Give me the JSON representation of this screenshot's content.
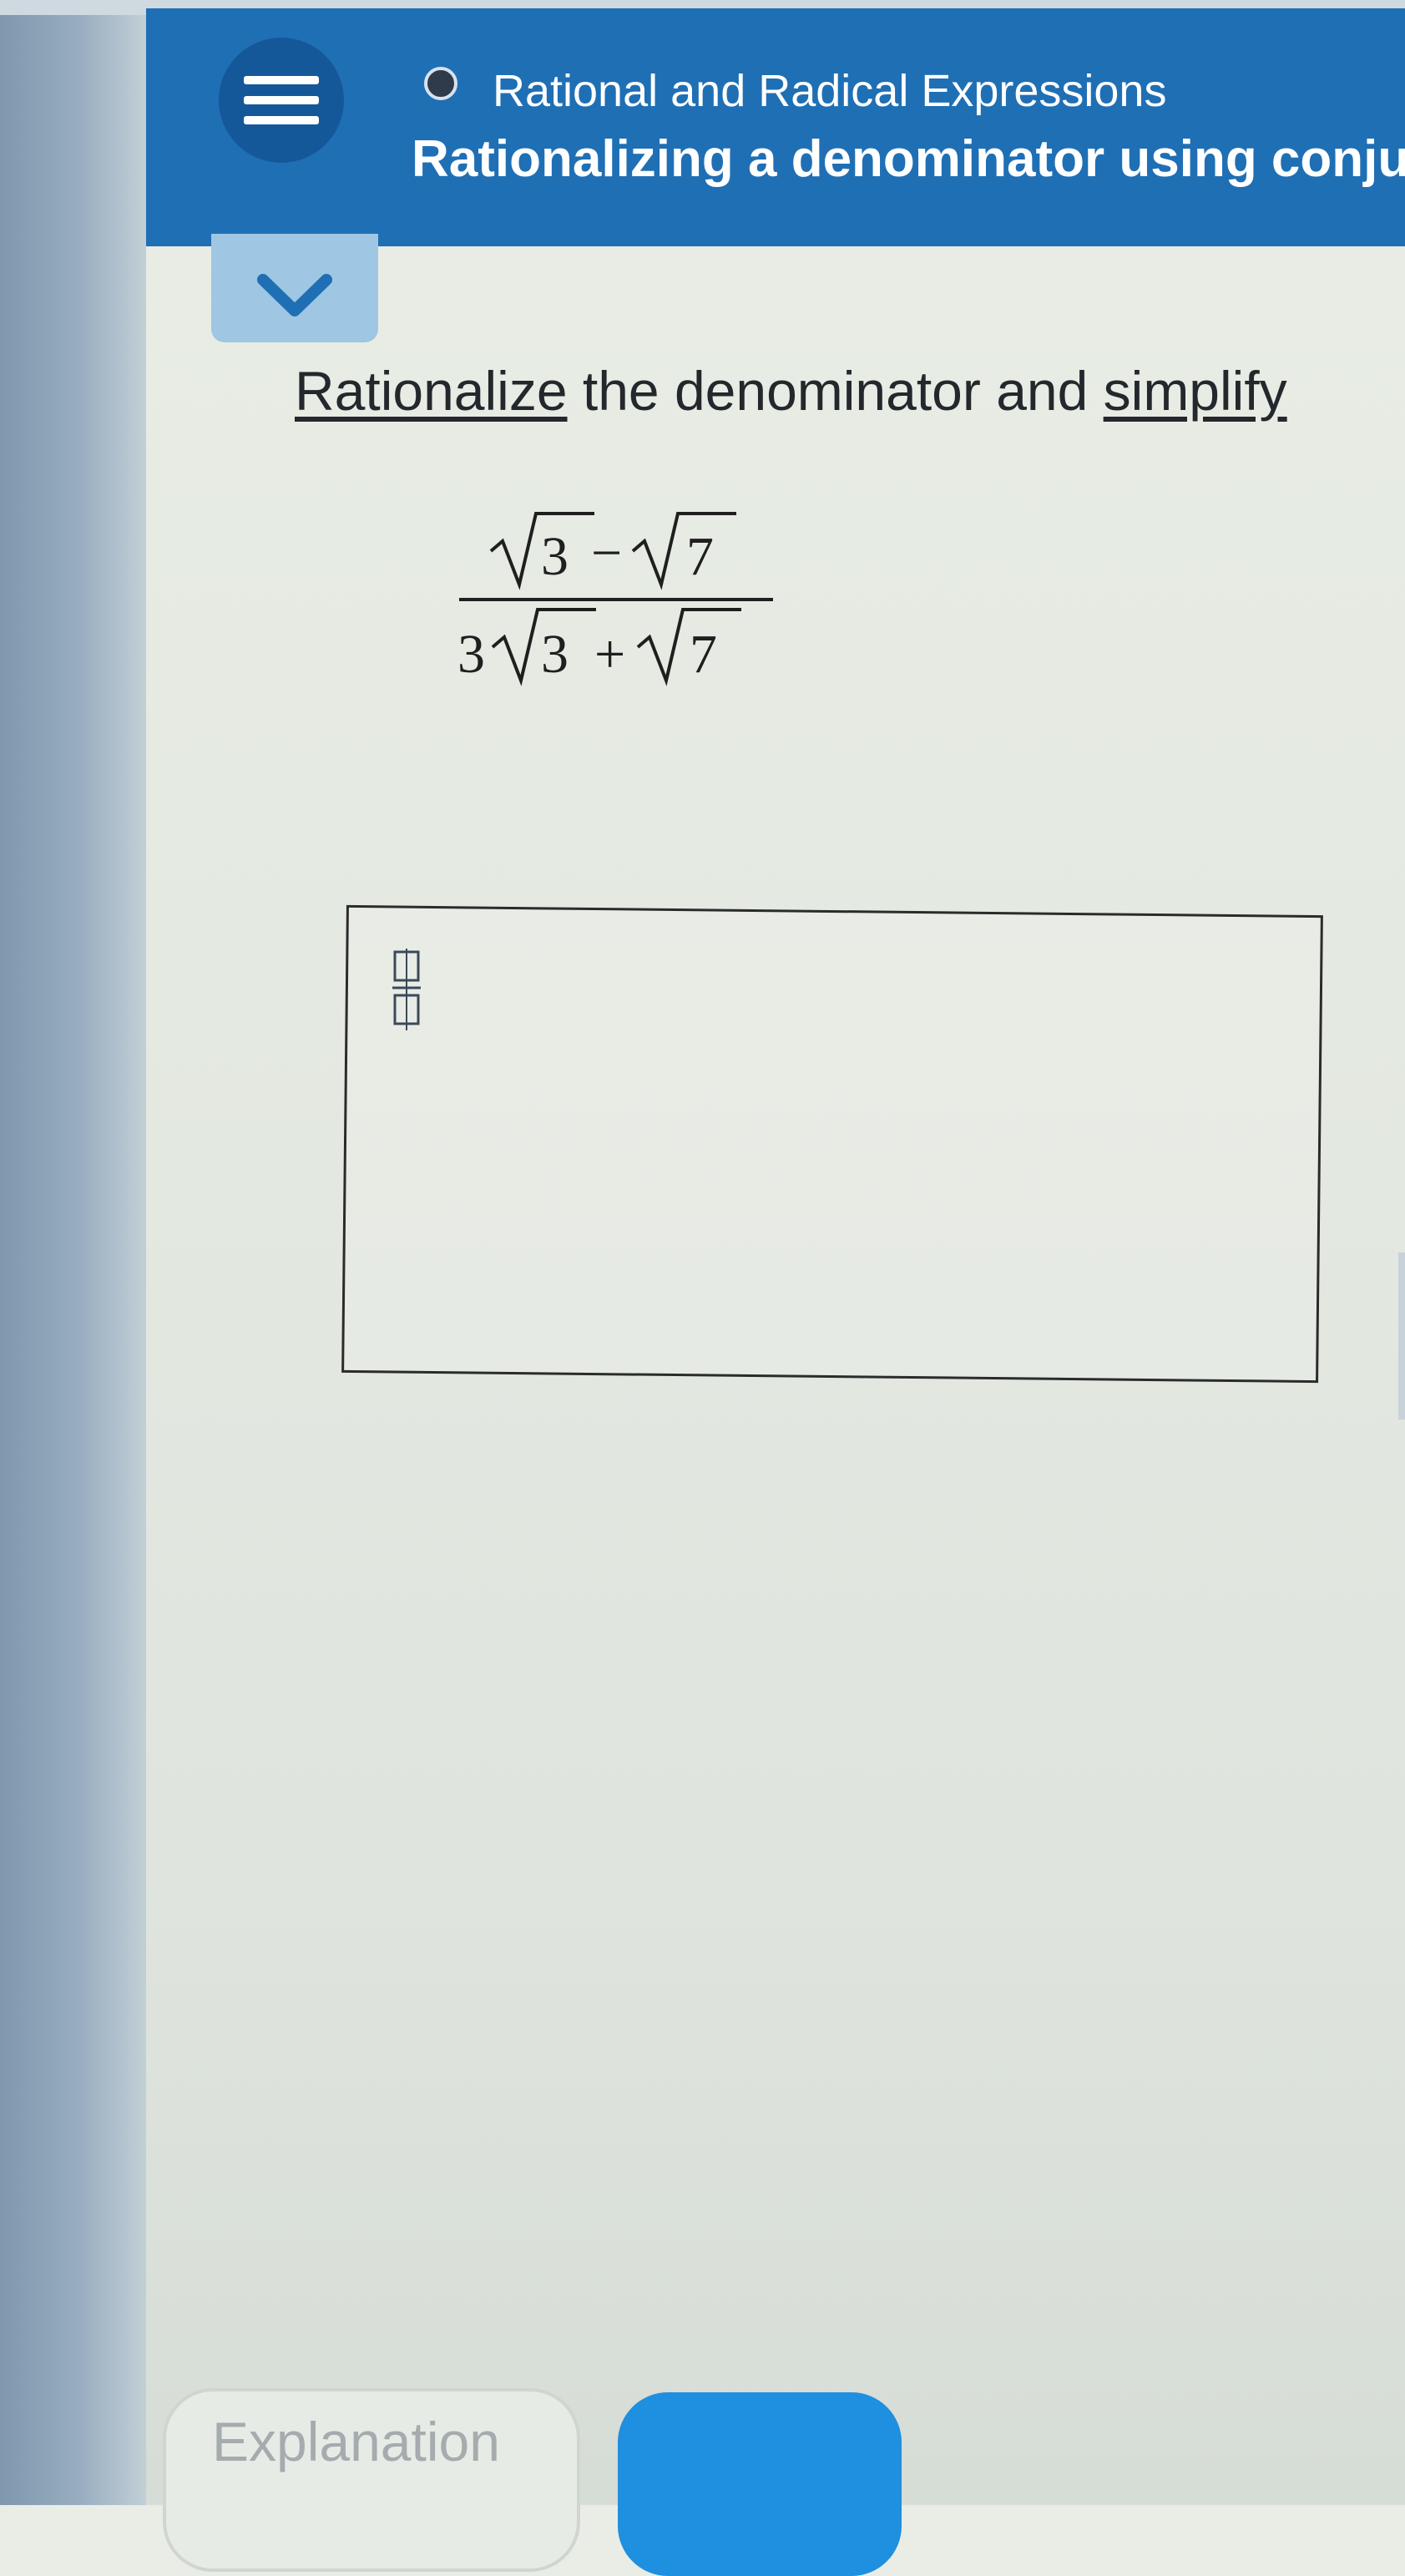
{
  "header": {
    "topic": "Rational and Radical Expressions",
    "subtopic": "Rationalizing a denominator using conjug"
  },
  "problem": {
    "prompt_link1": "Rationalize",
    "prompt_middle": " the denominator and ",
    "prompt_link2": "simplify",
    "numerator_a": "3",
    "operator_num": "−",
    "numerator_b": "7",
    "denominator_coeff": "3",
    "denominator_a": "3",
    "operator_den": "+",
    "denominator_b": "7"
  },
  "buttons": {
    "explanation": "Explanation"
  },
  "colors": {
    "header_bg": "#1f6fb5",
    "tab_bg": "#9fc6e2",
    "check_bg": "#1f8fe0"
  },
  "icons": [
    "menu-icon",
    "topic-dot-icon",
    "chevron-down-icon",
    "fraction-template-icon"
  ]
}
